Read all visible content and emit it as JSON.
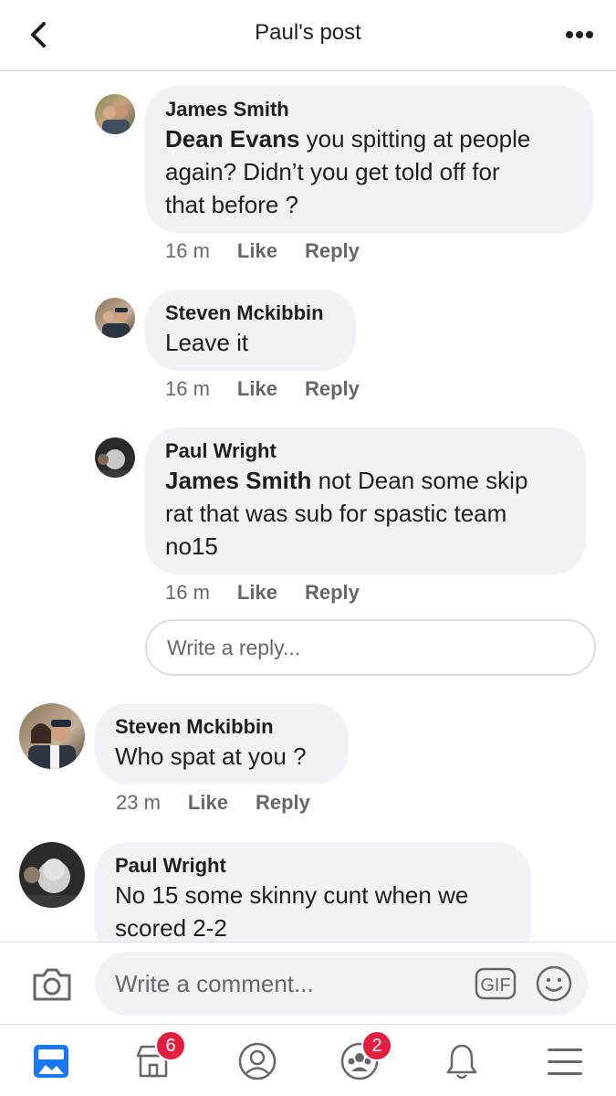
{
  "header": {
    "title": "Paul's post",
    "back_icon": "chevron-left-icon",
    "more_icon": "more-horizontal-icon"
  },
  "comments": [
    {
      "author": "James Smith",
      "mention": "Dean Evans",
      "text_lines": [
        " you spitting at people",
        "again? Didn’t you get told off for",
        "that before ?"
      ],
      "time": "16 m",
      "like": "Like",
      "reply": "Reply"
    },
    {
      "author": "Steven Mckibbin",
      "text_lines": [
        "Leave it"
      ],
      "time": "16 m",
      "like": "Like",
      "reply": "Reply"
    },
    {
      "author": "Paul Wright",
      "mention": "James Smith",
      "text_lines": [
        " not Dean some skip",
        "rat that was sub for spastic team",
        "no15"
      ],
      "time": "16 m",
      "like": "Like",
      "reply": "Reply"
    },
    {
      "author": "Steven Mckibbin",
      "text_lines": [
        "Who spat at you ?"
      ],
      "time": "23 m",
      "like": "Like",
      "reply": "Reply"
    },
    {
      "author": "Paul Wright",
      "text_lines": [
        "No 15 some skinny cunt when we",
        "scored 2-2"
      ]
    }
  ],
  "reply_box": {
    "placeholder": "Write a reply..."
  },
  "composer": {
    "placeholder": "Write a comment...",
    "camera_icon": "camera-icon",
    "gif_label": "GIF",
    "emoji_icon": "emoji-icon"
  },
  "nav": {
    "items": [
      {
        "icon": "news-feed-icon",
        "active": true
      },
      {
        "icon": "marketplace-icon",
        "badge": "6"
      },
      {
        "icon": "profile-icon"
      },
      {
        "icon": "groups-icon",
        "badge": "2"
      },
      {
        "icon": "notifications-bell-icon"
      },
      {
        "icon": "menu-icon"
      }
    ]
  },
  "colors": {
    "accent": "#1877f2",
    "bubble": "#f0f2f5",
    "badge": "#e41e3f",
    "meta_text": "#65676b"
  }
}
